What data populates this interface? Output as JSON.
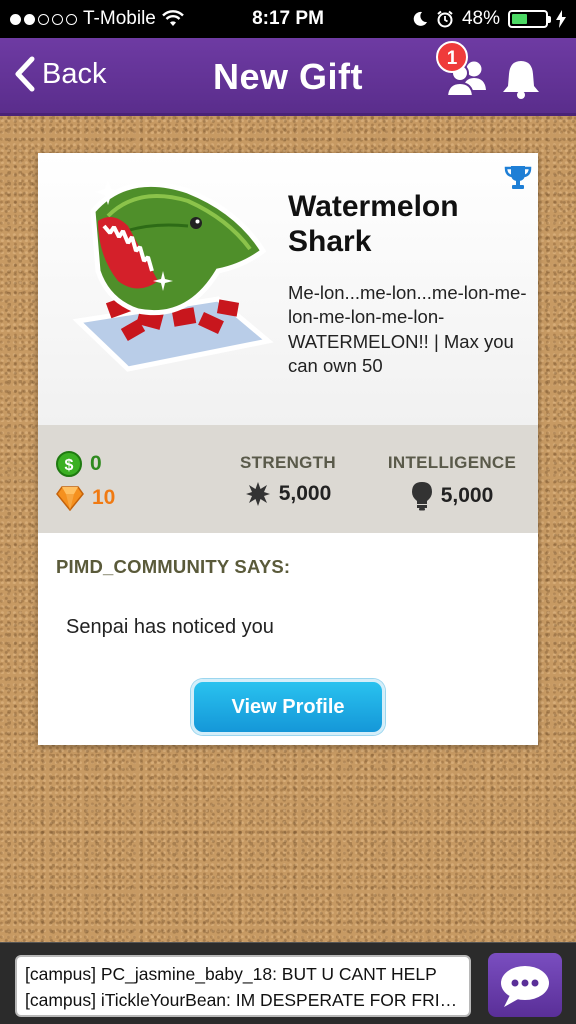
{
  "status_bar": {
    "carrier": "T-Mobile",
    "time": "8:17 PM",
    "battery": "48%",
    "battery_level": 0.48
  },
  "nav": {
    "back_label": "Back",
    "title": "New Gift",
    "friend_badge": "1"
  },
  "gift": {
    "name": "Watermelon Shark",
    "description": "Me-lon...me-lon...me-lon-me-lon-me-lon-me-lon-WATERMELON!! | Max you can own 50",
    "coins": "0",
    "gems": "10",
    "strength_label": "STRENGTH",
    "strength_value": "5,000",
    "intelligence_label": "INTELLIGENCE",
    "intelligence_value": "5,000"
  },
  "sender": {
    "says_label": "PIMD_COMMUNITY SAYS:",
    "message": "Senpai has noticed you",
    "view_profile_label": "View Profile"
  },
  "chat": {
    "lines": [
      "[campus] PC_jasmine_baby_18: BUT U CANT HELP",
      "[campus] iTickleYourBean: IM DESPERATE FOR FRIENDS"
    ]
  },
  "colors": {
    "nav_purple": "#5f3091",
    "cork": "#c79a63",
    "button_blue": "#1fa8e2",
    "coin_green": "#2f8a1f",
    "gem_orange": "#f07a12"
  },
  "icons": [
    "signal-dots-icon",
    "wifi-icon",
    "moon-icon",
    "alarm-icon",
    "battery-icon",
    "charging-icon",
    "chevron-left-icon",
    "friends-icon",
    "bell-icon",
    "trophy-icon",
    "coin-icon",
    "gem-icon",
    "strength-icon",
    "lightbulb-icon",
    "chat-bubble-icon"
  ]
}
